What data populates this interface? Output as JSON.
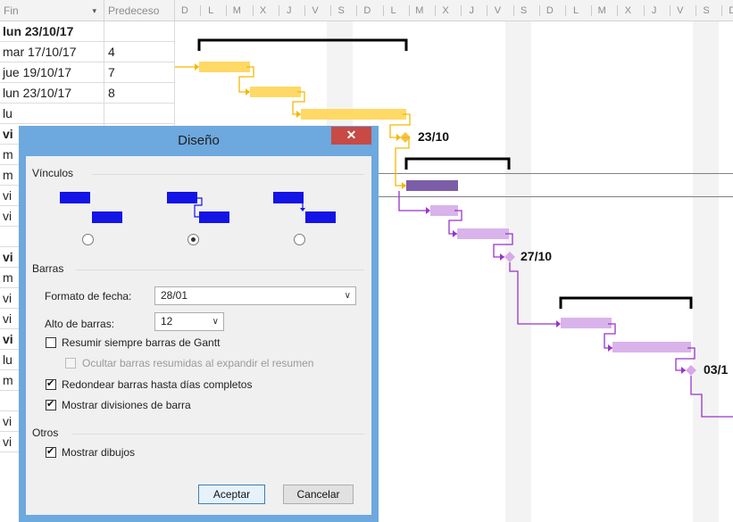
{
  "table": {
    "headers": {
      "fin": "Fin",
      "predecesoras": "Predeceso"
    },
    "rows": [
      {
        "fin": "lun 23/10/17",
        "pred": "",
        "bold": true
      },
      {
        "fin": "mar 17/10/17",
        "pred": "4",
        "bold": false
      },
      {
        "fin": "jue 19/10/17",
        "pred": "7",
        "bold": false
      },
      {
        "fin": "lun 23/10/17",
        "pred": "8",
        "bold": false
      },
      {
        "fin": "lu",
        "pred": "",
        "bold": false
      },
      {
        "fin": "vi",
        "pred": "",
        "bold": true
      },
      {
        "fin": "m",
        "pred": "",
        "bold": false
      },
      {
        "fin": "m",
        "pred": "",
        "bold": false
      },
      {
        "fin": "vi",
        "pred": "",
        "bold": false
      },
      {
        "fin": "vi",
        "pred": "",
        "bold": false
      },
      {
        "fin": "",
        "pred": "",
        "bold": false
      },
      {
        "fin": "vi",
        "pred": "",
        "bold": true
      },
      {
        "fin": "m",
        "pred": "",
        "bold": false
      },
      {
        "fin": "vi",
        "pred": "",
        "bold": false
      },
      {
        "fin": "vi",
        "pred": "",
        "bold": false
      },
      {
        "fin": "vi",
        "pred": "",
        "bold": true
      },
      {
        "fin": "lu",
        "pred": "",
        "bold": false
      },
      {
        "fin": "m",
        "pred": "",
        "bold": false
      },
      {
        "fin": "",
        "pred": "",
        "bold": false
      },
      {
        "fin": "vi",
        "pred": "",
        "bold": false
      },
      {
        "fin": "vi",
        "pred": "",
        "bold": false
      }
    ]
  },
  "gantt": {
    "days": [
      "D",
      "L",
      "M",
      "X",
      "J",
      "V",
      "S",
      "D",
      "L",
      "M",
      "X",
      "J",
      "V",
      "S",
      "D",
      "L",
      "M",
      "X",
      "J",
      "V",
      "S",
      "D"
    ],
    "milestones": [
      "23/10",
      "27/10",
      "03/1"
    ],
    "colors": {
      "task_yellow": "#ffd966",
      "task_yellow_link": "#f5b800",
      "summary_purple": "#7b5ea7",
      "task_lilac": "#d9b3ec",
      "link_purple": "#9933cc",
      "milestone_yellow": "#f5c542",
      "milestone_lilac": "#d9a8e8",
      "weekend": "#f3f3f3"
    }
  },
  "dialog": {
    "title": "Diseño",
    "close_icon": "close-icon",
    "links_section": "Vínculos",
    "bars_section": "Barras",
    "date_format_label": "Formato de fecha:",
    "date_format_value": "28/01",
    "bar_height_label": "Alto de barras:",
    "bar_height_value": "12",
    "opt_summarize": "Resumir siempre barras de Gantt",
    "opt_hide_summary": "Ocultar barras resumidas al expandir el resumen",
    "opt_round": "Redondear barras hasta días completos",
    "opt_splits": "Mostrar divisiones de barra",
    "other_section": "Otros",
    "opt_drawings": "Mostrar dibujos",
    "accept": "Aceptar",
    "cancel": "Cancelar",
    "checks": {
      "summarize": false,
      "hide_summary": false,
      "round": true,
      "splits": true,
      "drawings": true
    },
    "selected_link_style": 2
  }
}
